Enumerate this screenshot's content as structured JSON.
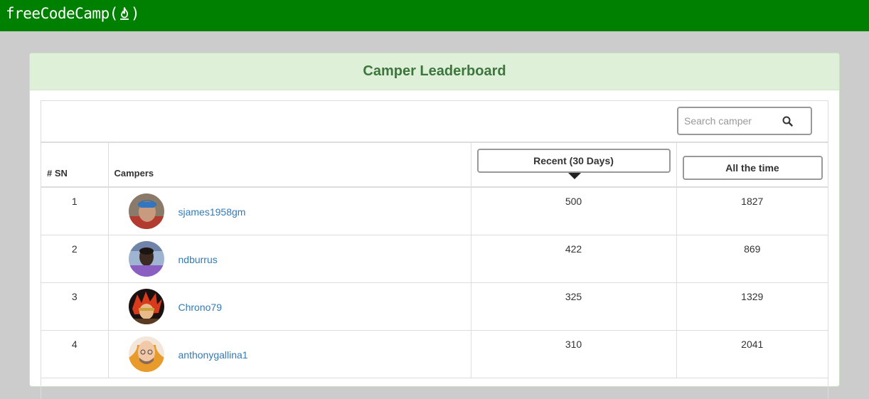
{
  "brand": {
    "name": "freeCodeCamp",
    "open_paren": "(",
    "close_paren": ")"
  },
  "panel": {
    "title": "Camper Leaderboard"
  },
  "search": {
    "placeholder": "Search camper",
    "value": ""
  },
  "table": {
    "headers": {
      "sn": "# SN",
      "campers": "Campers",
      "recent": "Recent (30 Days)",
      "alltime": "All the time"
    },
    "rows": [
      {
        "sn": "1",
        "name": "sjames1958gm",
        "recent": "500",
        "alltime": "1827"
      },
      {
        "sn": "2",
        "name": "ndburrus",
        "recent": "422",
        "alltime": "869"
      },
      {
        "sn": "3",
        "name": "Chrono79",
        "recent": "325",
        "alltime": "1329"
      },
      {
        "sn": "4",
        "name": "anthonygallina1",
        "recent": "310",
        "alltime": "2041"
      }
    ]
  },
  "colors": {
    "topbar": "#008000",
    "panel_heading_bg": "#dff0d8",
    "panel_title": "#3c763d",
    "link": "#337ab7",
    "background": "#cccccc"
  },
  "icons": {
    "brand_flame": "flame-icon",
    "search": "search-icon",
    "sort_caret": "caret-down-icon"
  }
}
